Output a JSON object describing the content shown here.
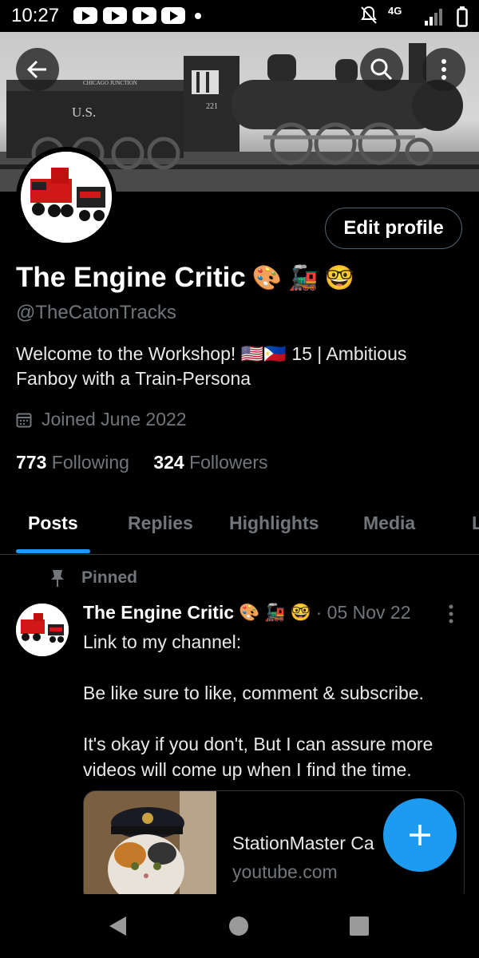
{
  "status_bar": {
    "time": "10:27",
    "network": "4G"
  },
  "profile": {
    "display_name": "The Engine Critic",
    "handle": "@TheCatonTracks",
    "bio": "Welcome to the Workshop! 🇺🇸🇵🇭 15 | Ambitious Fanboy with a Train-Persona",
    "joined": "Joined June 2022",
    "following_count": "773",
    "following_label": "Following",
    "followers_count": "324",
    "followers_label": "Followers",
    "edit_label": "Edit profile"
  },
  "banner": {
    "plate_text": "U.S.",
    "number": "221",
    "top_text": "CHICAGO JUNCTION"
  },
  "tabs": [
    {
      "label": "Posts",
      "active": true
    },
    {
      "label": "Replies"
    },
    {
      "label": "Highlights"
    },
    {
      "label": "Media"
    },
    {
      "label": "L"
    }
  ],
  "pinned_post": {
    "pinned_label": "Pinned",
    "author": "The Engine Critic",
    "date": "· 05 Nov 22",
    "line1": "Link to my channel:",
    "line2": "Be like sure to like, comment & subscribe.",
    "line3": "It's okay if you don't, But I can assure more videos will come up when I find the time.",
    "card_title": "StationMaster Ca",
    "card_domain": "youtube.com"
  },
  "colors": {
    "accent": "#1d9bf0",
    "secondary_text": "#71767b",
    "background": "#000000"
  }
}
